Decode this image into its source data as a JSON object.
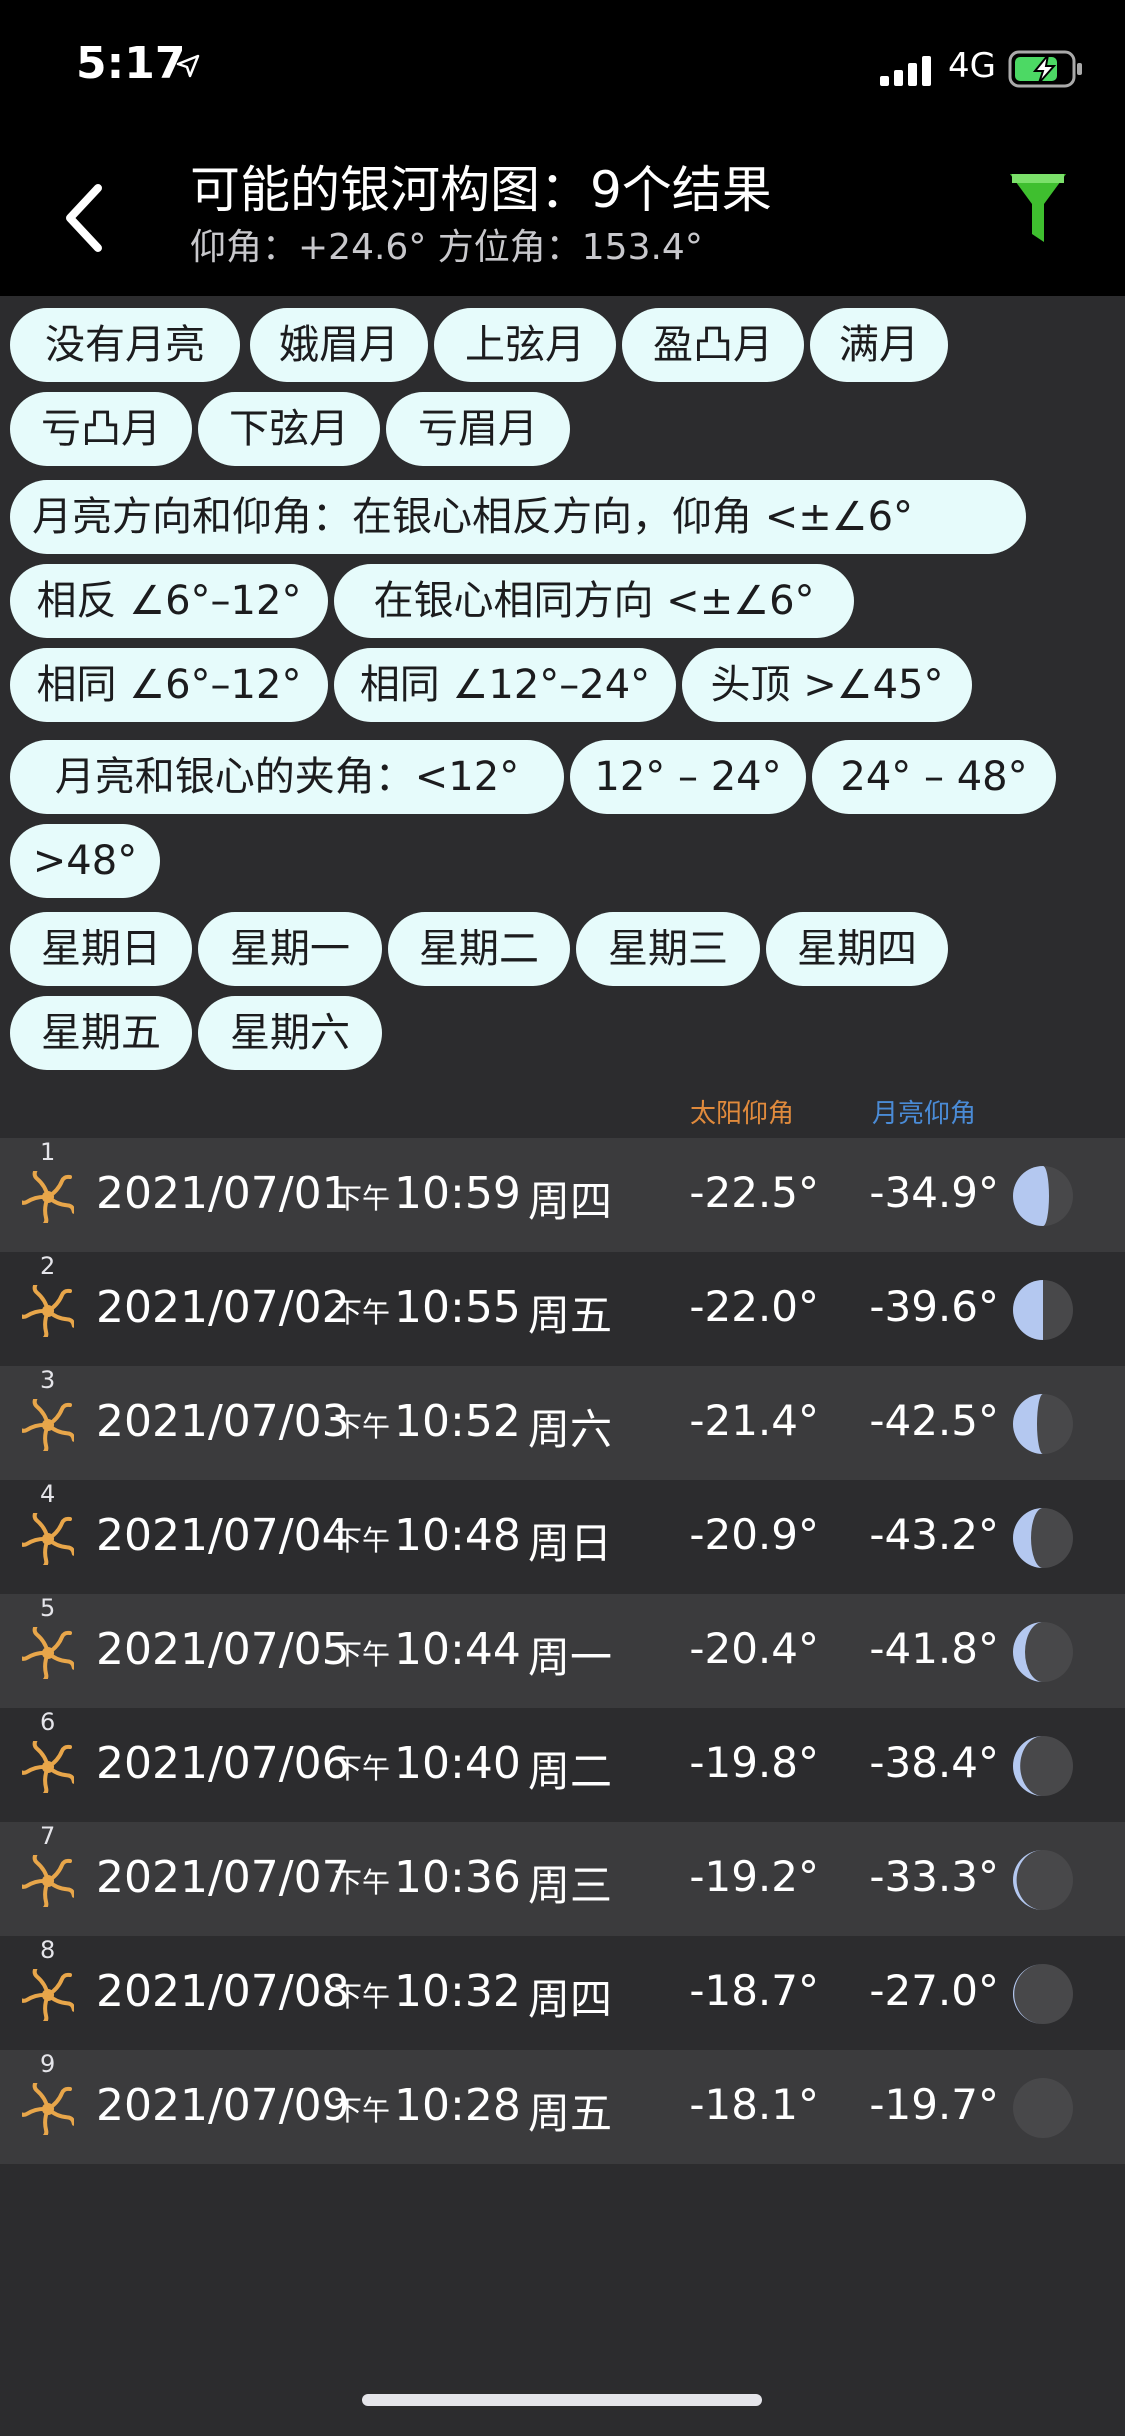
{
  "status": {
    "time": "5:17",
    "network": "4G"
  },
  "nav": {
    "title": "可能的银河构图：9个结果",
    "subtitle": "仰角：+24.6° 方位角：153.4°"
  },
  "chips": {
    "phases": [
      "没有月亮",
      "娥眉月",
      "上弦月",
      "盈凸月",
      "满月",
      "亏凸月",
      "下弦月",
      "亏眉月"
    ],
    "direction_label": "月亮方向和仰角：在银心相反方向，仰角 <±∠6°",
    "direction_opts": [
      "相反 ∠6°–12°",
      "在银心相同方向  <±∠6°",
      "相同 ∠6°–12°",
      "相同 ∠12°–24°",
      "头顶  >∠45°"
    ],
    "angle_label": "月亮和银心的夹角：<12°",
    "angle_opts": [
      "12° – 24°",
      "24° – 48°",
      ">48°"
    ],
    "weekdays": [
      "星期日",
      "星期一",
      "星期二",
      "星期三",
      "星期四",
      "星期五",
      "星期六"
    ]
  },
  "columns": {
    "sun": "太阳仰角",
    "moon": "月亮仰角"
  },
  "colors": {
    "chip_bg": "#e6fbfb",
    "sun_header": "#e08a3c",
    "moon_header": "#4a8bd6",
    "filter": "#3fbf2f",
    "moon_lit": "#b4c8f0"
  },
  "results": [
    {
      "index": "1",
      "date": "2021/07/01",
      "ampm": "下午",
      "time": "10:59",
      "day": "周四",
      "sun": "-22.5°",
      "moon": "-34.9°",
      "moon_lit_fraction": 0.6
    },
    {
      "index": "2",
      "date": "2021/07/02",
      "ampm": "下午",
      "time": "10:55",
      "day": "周五",
      "sun": "-22.0°",
      "moon": "-39.6°",
      "moon_lit_fraction": 0.5
    },
    {
      "index": "3",
      "date": "2021/07/03",
      "ampm": "下午",
      "time": "10:52",
      "day": "周六",
      "sun": "-21.4°",
      "moon": "-42.5°",
      "moon_lit_fraction": 0.4
    },
    {
      "index": "4",
      "date": "2021/07/04",
      "ampm": "下午",
      "time": "10:48",
      "day": "周日",
      "sun": "-20.9°",
      "moon": "-43.2°",
      "moon_lit_fraction": 0.3
    },
    {
      "index": "5",
      "date": "2021/07/05",
      "ampm": "下午",
      "time": "10:44",
      "day": "周一",
      "sun": "-20.4°",
      "moon": "-41.8°",
      "moon_lit_fraction": 0.2
    },
    {
      "index": "6",
      "date": "2021/07/06",
      "ampm": "下午",
      "time": "10:40",
      "day": "周二",
      "sun": "-19.8°",
      "moon": "-38.4°",
      "moon_lit_fraction": 0.12
    },
    {
      "index": "7",
      "date": "2021/07/07",
      "ampm": "下午",
      "time": "10:36",
      "day": "周三",
      "sun": "-19.2°",
      "moon": "-33.3°",
      "moon_lit_fraction": 0.06
    },
    {
      "index": "8",
      "date": "2021/07/08",
      "ampm": "下午",
      "time": "10:32",
      "day": "周四",
      "sun": "-18.7°",
      "moon": "-27.0°",
      "moon_lit_fraction": 0.02
    },
    {
      "index": "9",
      "date": "2021/07/09",
      "ampm": "下午",
      "time": "10:28",
      "day": "周五",
      "sun": "-18.1°",
      "moon": "-19.7°",
      "moon_lit_fraction": 0.0
    }
  ]
}
